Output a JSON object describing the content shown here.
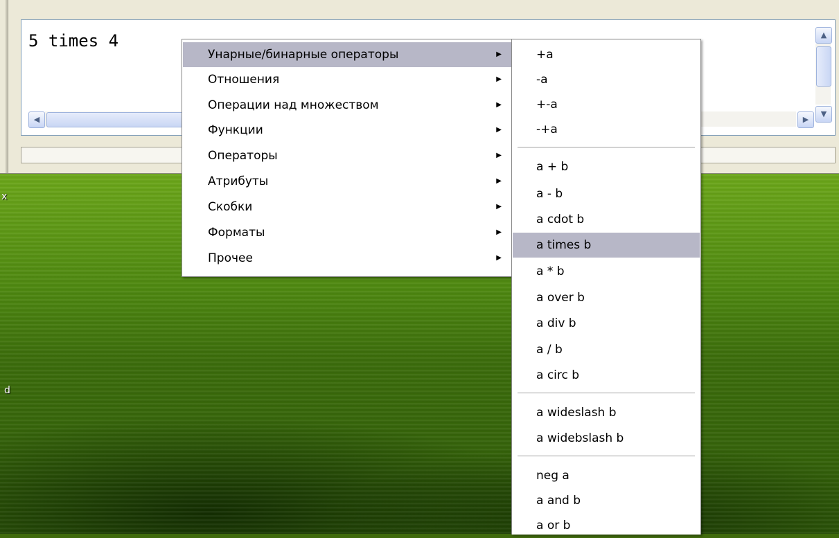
{
  "editor": {
    "formula_text": "5 times 4"
  },
  "desktop": {
    "glyph_x": "x",
    "glyph_d": "d"
  },
  "icons": {
    "scroll_up": "scroll-up-arrow-icon",
    "scroll_down": "scroll-down-arrow-icon",
    "scroll_left": "scroll-left-arrow-icon",
    "scroll_right": "scroll-right-arrow-icon",
    "submenu": "submenu-arrow-icon"
  },
  "colors": {
    "menu_highlight": "#b7b7c7",
    "editor_border": "#7f9db9",
    "window_bg": "#ece9d8"
  },
  "context_menu": {
    "items": [
      {
        "label": "Унарные/бинарные операторы",
        "highlighted": true
      },
      {
        "label": "Отношения"
      },
      {
        "label": "Операции над множеством"
      },
      {
        "label": "Функции"
      },
      {
        "label": "Операторы"
      },
      {
        "label": "Атрибуты"
      },
      {
        "label": "Скобки"
      },
      {
        "label": "Форматы"
      },
      {
        "label": "Прочее"
      }
    ],
    "submenu_arrow": "▶"
  },
  "submenu": {
    "items": [
      {
        "label": "+a"
      },
      {
        "label": "-a"
      },
      {
        "label": "+-a"
      },
      {
        "label": "-+a"
      },
      {
        "label": "a + b"
      },
      {
        "label": "a - b"
      },
      {
        "label": "a cdot b"
      },
      {
        "label": "a times b",
        "highlighted": true
      },
      {
        "label": "a * b"
      },
      {
        "label": "a over b"
      },
      {
        "label": "a div b"
      },
      {
        "label": "a / b"
      },
      {
        "label": "a circ b"
      },
      {
        "label": "a wideslash b"
      },
      {
        "label": "a widebslash b"
      },
      {
        "label": "neg a"
      },
      {
        "label": "a and b"
      },
      {
        "label": "a or b"
      }
    ]
  }
}
